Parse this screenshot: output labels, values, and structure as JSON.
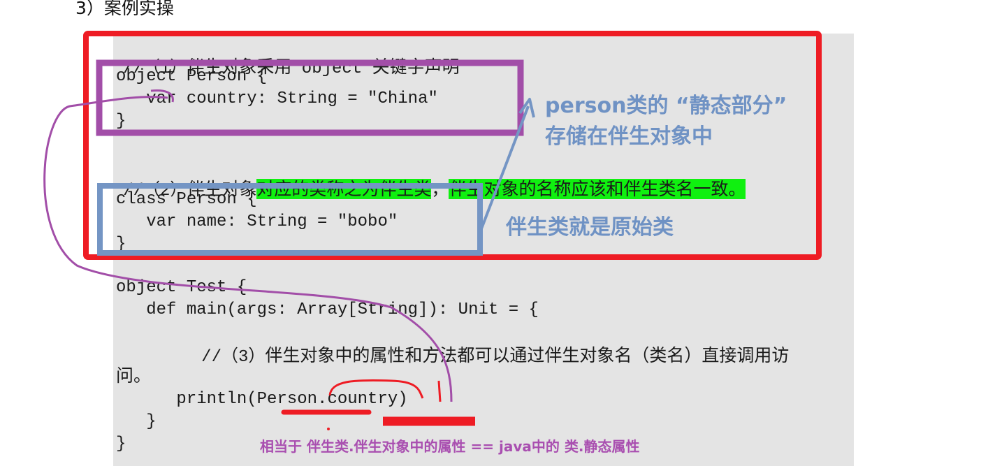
{
  "heading": "3）案例实操",
  "comments": {
    "c1_prefix": "//（1）",
    "c1_text_a": "伴生对象采用",
    "c1_code": " object ",
    "c1_text_b": "关键字声明",
    "c2_prefix": "//（2）",
    "c2_text_a": "伴生对象",
    "c2_hl_a": "对应的类称之为伴生类",
    "c2_text_b": "，",
    "c2_hl_b": "伴生对象的名称应该和伴生类名一致。",
    "c3_prefix": "//（3）",
    "c3_text": "伴生对象中的属性和方法都可以通过伴生对象名（类名）直接调用访",
    "c3_wrap": "问。"
  },
  "code": {
    "obj_open": "object Person {",
    "obj_var": "   var country: String = \"China\"",
    "close": "}",
    "class_open": "class Person {",
    "class_var": "   var name: String = \"bobo\"",
    "test_open": "object Test {",
    "main_open": "   def main(args: Array[String]): Unit = {",
    "println": "      println(Person.country)",
    "main_close": "   }",
    "test_close": "}"
  },
  "annotations": {
    "static_line1": "person类的 “静态部分”",
    "static_line2": "存储在伴生对象中",
    "companion_class": "伴生类就是原始类",
    "equivalent": "相当于 伴生类.伴生对象中的属性 == java中的 类.静态属性"
  },
  "colors": {
    "red_box": "#ee1c24",
    "purple_box": "#a24ea8",
    "blue_box": "#7495c4",
    "highlight": "#10f010",
    "code_bg": "#e4e4e4"
  }
}
